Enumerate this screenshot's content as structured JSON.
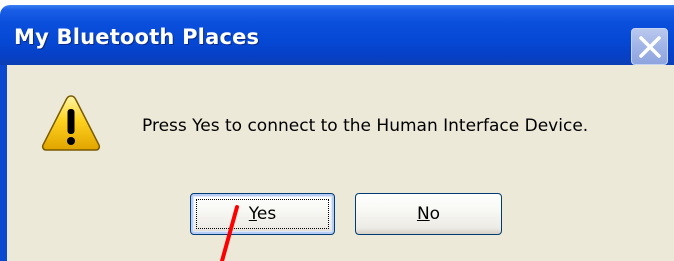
{
  "window": {
    "title": "My Bluetooth Places",
    "title_bar_color": "#0548d4"
  },
  "dialog": {
    "message": "Press Yes to connect to the Human Interface Device.",
    "icon": "warning-icon"
  },
  "buttons": {
    "yes": {
      "accel": "Y",
      "rest": "es"
    },
    "no": {
      "accel": "N",
      "rest": "o"
    }
  },
  "annotation": {
    "pointer_color": "#ff0000"
  }
}
